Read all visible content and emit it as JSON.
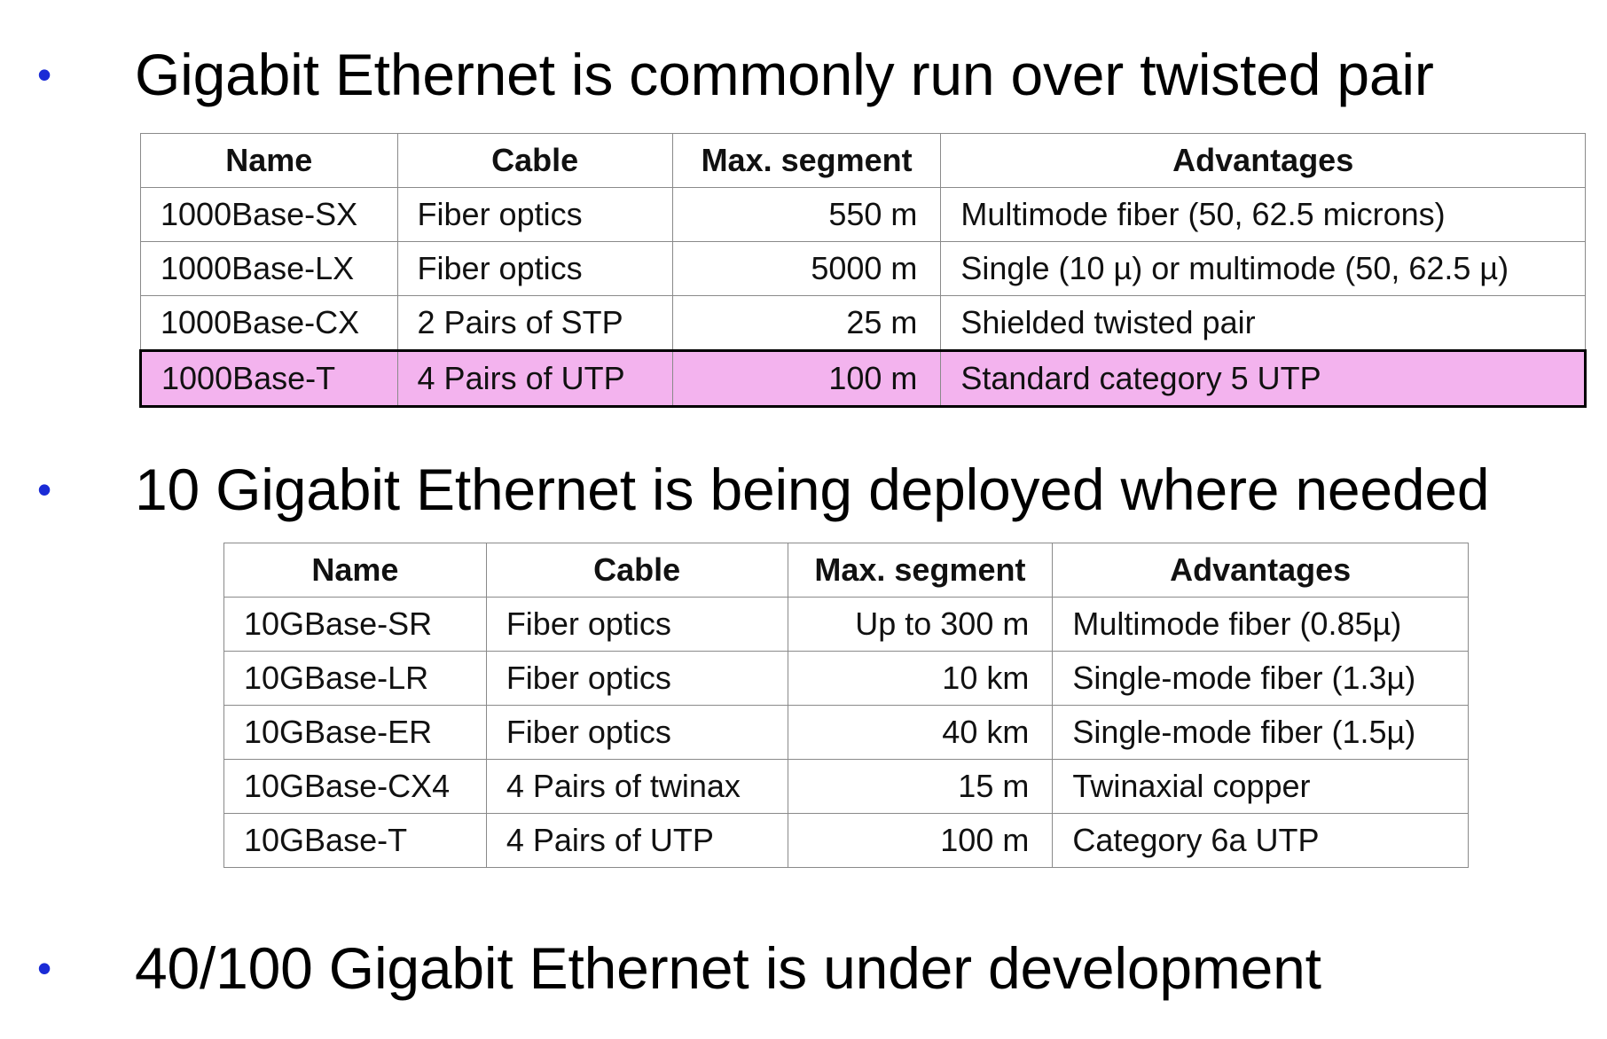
{
  "bullets": [
    {
      "text": "Gigabit Ethernet is commonly run over twisted pair"
    },
    {
      "text": "10 Gigabit Ethernet is being deployed where needed"
    },
    {
      "text": "40/100 Gigabit Ethernet is under development"
    }
  ],
  "bullet_symbol": "•",
  "colors": {
    "bullet": "#1a2bd6",
    "highlight_row": "#f3b3ee"
  },
  "gigabit_table": {
    "headers": [
      "Name",
      "Cable",
      "Max. segment",
      "Advantages"
    ],
    "rows": [
      [
        "1000Base-SX",
        "Fiber optics",
        "550 m",
        "Multimode fiber (50, 62.5 microns)"
      ],
      [
        "1000Base-LX",
        "Fiber optics",
        "5000 m",
        "Single (10 µ) or multimode (50, 62.5 µ)"
      ],
      [
        "1000Base-CX",
        "2 Pairs of STP",
        "25 m",
        "Shielded twisted pair"
      ],
      [
        "1000Base-T",
        "4 Pairs of UTP",
        "100 m",
        "Standard category 5 UTP"
      ]
    ],
    "highlighted_row": 3
  },
  "ten_gigabit_table": {
    "headers": [
      "Name",
      "Cable",
      "Max. segment",
      "Advantages"
    ],
    "rows": [
      [
        "10GBase-SR",
        "Fiber optics",
        "Up to 300 m",
        "Multimode fiber (0.85µ)"
      ],
      [
        "10GBase-LR",
        "Fiber optics",
        "10 km",
        "Single-mode fiber (1.3µ)"
      ],
      [
        "10GBase-ER",
        "Fiber optics",
        "40 km",
        "Single-mode fiber (1.5µ)"
      ],
      [
        "10GBase-CX4",
        "4 Pairs of twinax",
        "15 m",
        "Twinaxial copper"
      ],
      [
        "10GBase-T",
        "4 Pairs of UTP",
        "100 m",
        "Category 6a UTP"
      ]
    ]
  }
}
